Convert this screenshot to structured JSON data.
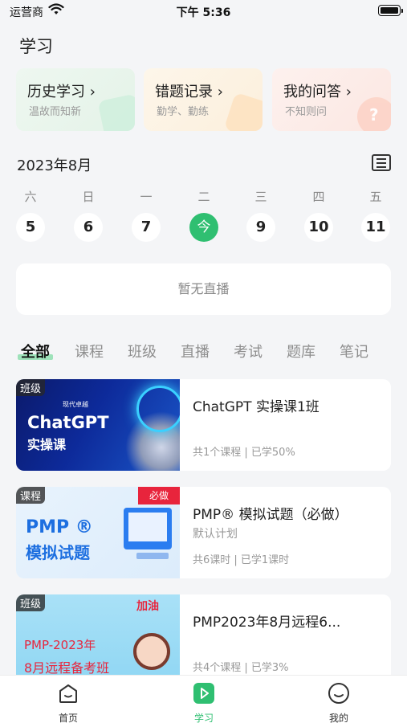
{
  "status_bar": {
    "carrier": "运营商",
    "time": "下午 5:36"
  },
  "page_title": "学习",
  "quick_links": [
    {
      "title": "历史学习 ›",
      "subtitle": "温故而知新"
    },
    {
      "title": "错题记录 ›",
      "subtitle": "勤学、勤练"
    },
    {
      "title": "我的问答 ›",
      "subtitle": "不知则问"
    }
  ],
  "calendar": {
    "month": "2023年8月",
    "weekdays": [
      "六",
      "日",
      "一",
      "二",
      "三",
      "四",
      "五"
    ],
    "days": [
      "5",
      "6",
      "7",
      "今",
      "9",
      "10",
      "11"
    ],
    "selected_index": 3
  },
  "live_empty": "暂无直播",
  "filter_tabs": [
    "全部",
    "课程",
    "班级",
    "直播",
    "考试",
    "题库",
    "笔记"
  ],
  "active_tab": "全部",
  "courses": [
    {
      "badge": "班级",
      "title": "ChatGPT 实操课1班",
      "subtitle": "",
      "meta": "共1个课程 | 已学50%",
      "thumb_line1": "ChatGPT",
      "thumb_line2": "实操课",
      "thumb_small": "现代卓越"
    },
    {
      "badge": "课程",
      "title": "PMP® 模拟试题（必做）",
      "subtitle": "默认计划",
      "meta": "共6课时 | 已学1课时",
      "thumb_line1": "PMP ®",
      "thumb_line2": "模拟试题",
      "thumb_tag": "必做"
    },
    {
      "badge": "班级",
      "title": "PMP2023年8月远程6...",
      "subtitle": "",
      "meta": "共4个课程 | 已学3%",
      "thumb_line1": "PMP-2023年",
      "thumb_line2": "8月远程备考班",
      "thumb_deco": "加油"
    }
  ],
  "bottom_nav": [
    {
      "label": "首页"
    },
    {
      "label": "学习"
    },
    {
      "label": "我的"
    }
  ],
  "colors": {
    "accent": "#2fbf71",
    "highlight": "#9ee2ba"
  }
}
